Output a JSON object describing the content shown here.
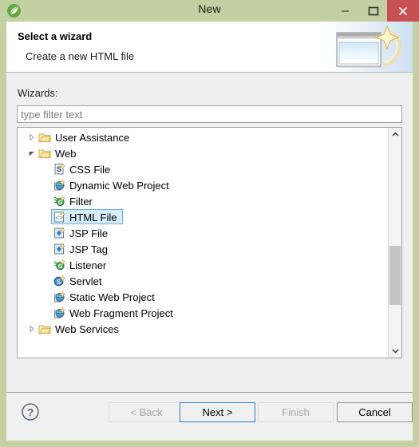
{
  "window": {
    "title": "New",
    "app_icon": "spring-leaf-icon",
    "frame_color": "#c2d0a2",
    "controls": {
      "minimize": "minimize-icon",
      "maximize": "maximize-icon",
      "close": "close-icon",
      "close_bg": "#c75050"
    }
  },
  "header": {
    "title": "Select a wizard",
    "subtitle": "Create a new HTML file",
    "banner_icon": "wizard-window-sparkle-icon"
  },
  "main": {
    "wizards_label": "Wizards:",
    "filter": {
      "placeholder": "type filter text",
      "value": ""
    },
    "tree": {
      "selection_bg": "#d5ecfb",
      "selection_border": "#70aedb",
      "items": [
        {
          "label": "User Assistance",
          "level": 0,
          "twisty": "collapsed",
          "icon": "folder-icon",
          "selected": false
        },
        {
          "label": "Web",
          "level": 0,
          "twisty": "expanded",
          "icon": "folder-icon",
          "selected": false
        },
        {
          "label": "CSS File",
          "level": 1,
          "twisty": "none",
          "icon": "css-file-icon",
          "selected": false
        },
        {
          "label": "Dynamic Web Project",
          "level": 1,
          "twisty": "none",
          "icon": "dynamic-web-project-icon",
          "selected": false
        },
        {
          "label": "Filter",
          "level": 1,
          "twisty": "none",
          "icon": "filter-icon",
          "selected": false
        },
        {
          "label": "HTML File",
          "level": 1,
          "twisty": "none",
          "icon": "html-file-icon",
          "selected": true
        },
        {
          "label": "JSP File",
          "level": 1,
          "twisty": "none",
          "icon": "jsp-file-icon",
          "selected": false
        },
        {
          "label": "JSP Tag",
          "level": 1,
          "twisty": "none",
          "icon": "jsp-tag-icon",
          "selected": false
        },
        {
          "label": "Listener",
          "level": 1,
          "twisty": "none",
          "icon": "listener-icon",
          "selected": false
        },
        {
          "label": "Servlet",
          "level": 1,
          "twisty": "none",
          "icon": "servlet-icon",
          "selected": false
        },
        {
          "label": "Static Web Project",
          "level": 1,
          "twisty": "none",
          "icon": "static-web-project-icon",
          "selected": false
        },
        {
          "label": "Web Fragment Project",
          "level": 1,
          "twisty": "none",
          "icon": "web-fragment-project-icon",
          "selected": false
        },
        {
          "label": "Web Services",
          "level": 0,
          "twisty": "collapsed",
          "icon": "folder-icon",
          "selected": false
        }
      ]
    },
    "scrollbar": {
      "up_arrow": "chevron-up-icon",
      "down_arrow": "chevron-down-icon",
      "thumb_color": "#c4c4c4"
    }
  },
  "footer": {
    "help_icon": "help-question-icon",
    "buttons": [
      {
        "label": "< Back",
        "state": "disabled"
      },
      {
        "label": "Next >",
        "state": "default"
      },
      {
        "label": "Finish",
        "state": "disabled"
      },
      {
        "label": "Cancel",
        "state": "normal"
      }
    ]
  }
}
